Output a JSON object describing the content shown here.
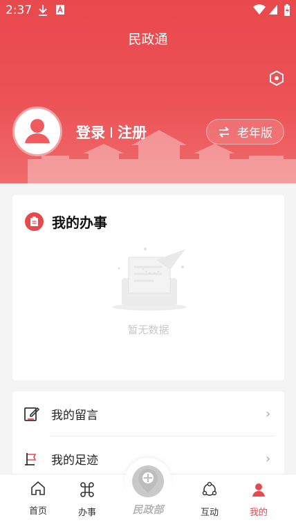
{
  "status_bar": {
    "time": "2:37"
  },
  "header": {
    "title": "民政通"
  },
  "user": {
    "login": "登录",
    "register": "注册"
  },
  "elder_mode": {
    "label": "老年版"
  },
  "affairs": {
    "title": "我的办事",
    "empty_text": "暂无数据"
  },
  "menu": [
    {
      "label": "我的留言",
      "icon": "message-edit-icon"
    },
    {
      "label": "我的足迹",
      "icon": "footprint-icon"
    }
  ],
  "tabs": [
    {
      "label": "首页",
      "icon": "home-icon"
    },
    {
      "label": "办事",
      "icon": "command-icon"
    },
    {
      "label": "民政部",
      "icon": "ministry-logo-icon"
    },
    {
      "label": "互动",
      "icon": "interaction-icon"
    },
    {
      "label": "我的",
      "icon": "person-icon",
      "active": true
    }
  ],
  "colors": {
    "accent": "#e8494d",
    "active_tab": "#e8494d",
    "inactive_tab": "#333333"
  }
}
